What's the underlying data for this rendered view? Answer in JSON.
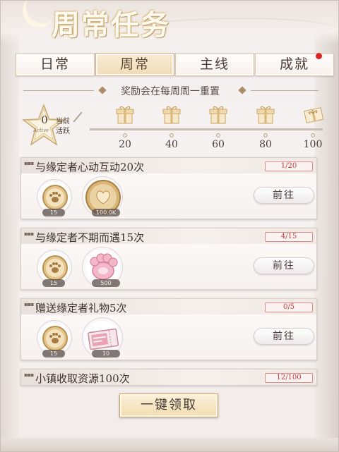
{
  "title": "周常任务",
  "tabs": [
    {
      "label": "日常",
      "active": false
    },
    {
      "label": "周常",
      "active": true
    },
    {
      "label": "主线",
      "active": false
    },
    {
      "label": "成就",
      "active": false,
      "has_notification": true
    }
  ],
  "notice": "奖励会在每周周一重置",
  "activity": {
    "value": "0",
    "star_subtext": "Active",
    "label": "当前活跃",
    "milestones": [
      "20",
      "40",
      "60",
      "80",
      "100"
    ]
  },
  "tasks": [
    {
      "name": "与缘定者心动互动20次",
      "progress": "1/20",
      "go_label": "前往",
      "rewards": [
        {
          "icon": "paw-coin-icon",
          "qty": "15"
        },
        {
          "icon": "heart-coin-icon",
          "qty": "100.0K"
        }
      ]
    },
    {
      "name": "与缘定者不期而遇15次",
      "progress": "4/15",
      "go_label": "前往",
      "rewards": [
        {
          "icon": "paw-coin-icon",
          "qty": "15"
        },
        {
          "icon": "pink-paw-icon",
          "qty": "500"
        }
      ]
    },
    {
      "name": "赠送缘定者礼物5次",
      "progress": "0/5",
      "go_label": "前往",
      "rewards": [
        {
          "icon": "paw-coin-icon",
          "qty": "15"
        },
        {
          "icon": "ticket-icon",
          "qty": "10"
        }
      ]
    },
    {
      "name": "小镇收取资源100次",
      "progress": "12/100",
      "go_label": "前往",
      "rewards": []
    }
  ],
  "claim_all": "一键领取",
  "colors": {
    "accent_gold": "#d9bf8a",
    "progress_red": "#c23a3a",
    "notification": "#e02424"
  }
}
